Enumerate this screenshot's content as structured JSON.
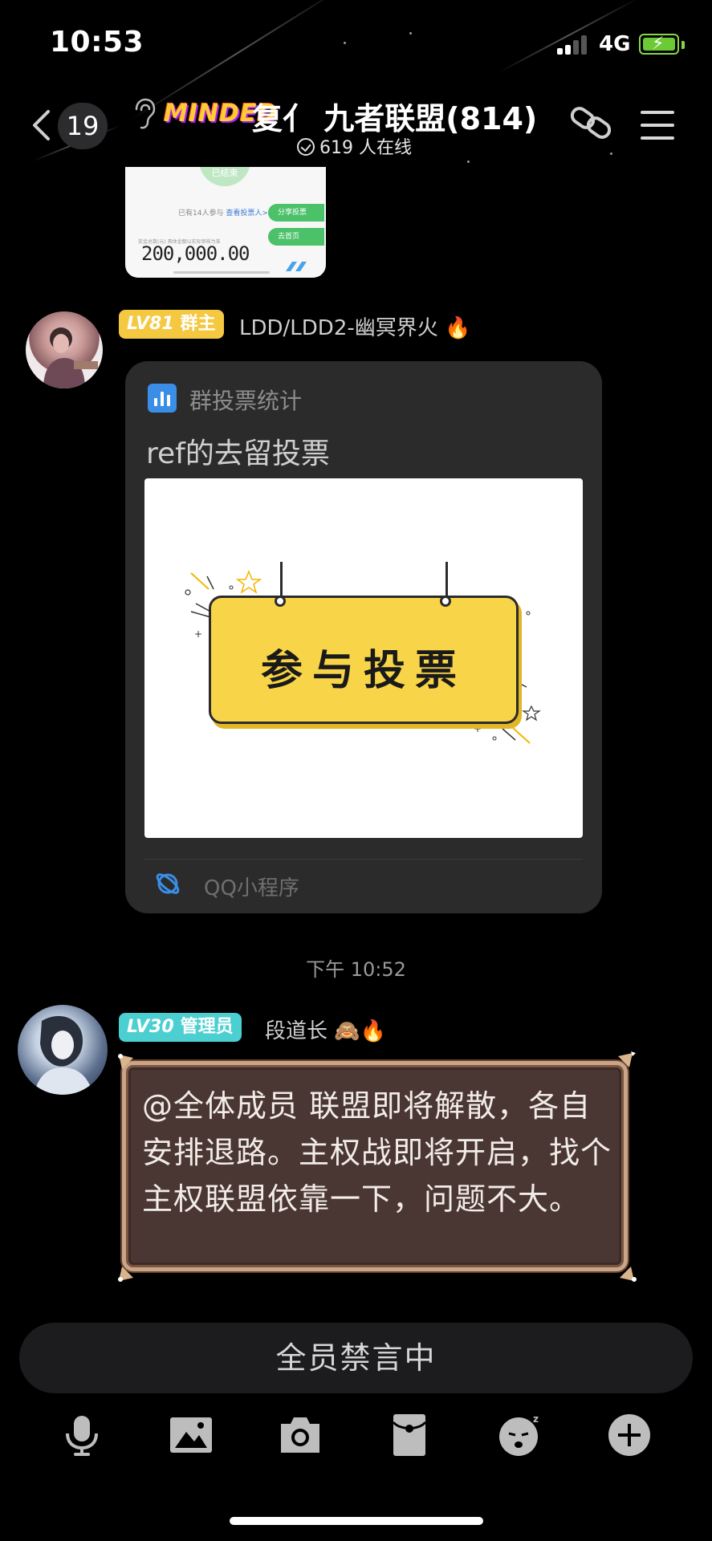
{
  "status_bar": {
    "time": "10:53",
    "network": "4G",
    "battery_charging": true
  },
  "nav": {
    "unread_count": "19",
    "brand_logo": "MINDED",
    "title": "复亻 九者联盟(814)",
    "online_text": "619 人在线"
  },
  "prev_message": {
    "circle_text": "已结束",
    "participants_prefix": "已有14人参与",
    "participants_link": "查看投票人>",
    "share_button": "分享投票",
    "home_button": "去首页",
    "amount_caption": "奖金总数(元) 具体金额以实际审核为准",
    "amount": "200,000.00"
  },
  "messages": [
    {
      "badge_level": "LV81",
      "badge_role": "群主",
      "badge_color": "#f5c842",
      "nickname": "LDD/LDD2-幽冥界火",
      "emoji": "🔥",
      "card": {
        "app_name": "群投票统计",
        "title": "ref的去留投票",
        "image_text": "参与投票",
        "footer": "QQ小程序"
      }
    },
    {
      "badge_level": "LV30",
      "badge_role": "管理员",
      "badge_color": "#4ccfd0",
      "nickname": "段道长",
      "emoji": "🙈🔥",
      "text": "@全体成员 联盟即将解散，各自安排退路。主权战即将开启，找个主权联盟依靠一下，问题不大。"
    }
  ],
  "timestamp": "下午 10:52",
  "input": {
    "muted_text": "全员禁言中"
  },
  "toolbar": [
    "microphone-icon",
    "image-icon",
    "camera-icon",
    "red-packet-icon",
    "emoji-icon",
    "plus-icon"
  ]
}
